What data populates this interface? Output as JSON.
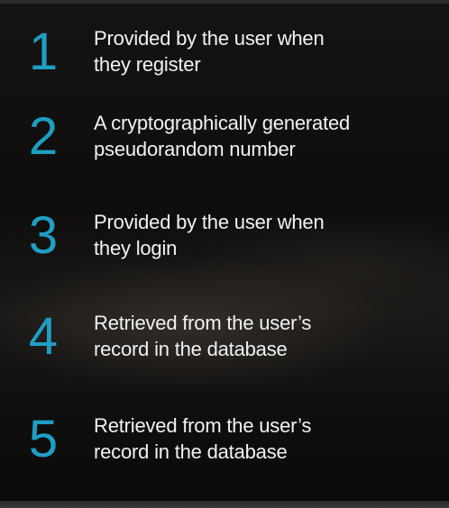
{
  "items": [
    {
      "number": "1",
      "line1": "Provided by the user when",
      "line2": "they register"
    },
    {
      "number": "2",
      "line1": "A cryptographically generated",
      "line2": "pseudorandom number"
    },
    {
      "number": "3",
      "line1": "Provided by the user when",
      "line2": "they login"
    },
    {
      "number": "4",
      "line1": "Retrieved from the user’s",
      "line2": "record in the database"
    },
    {
      "number": "5",
      "line1": "Retrieved from the user’s",
      "line2": "record in the database"
    }
  ],
  "colors": {
    "accent": "#1f9ec4",
    "text": "#f2f2f2",
    "background": "#0e0d0c"
  }
}
